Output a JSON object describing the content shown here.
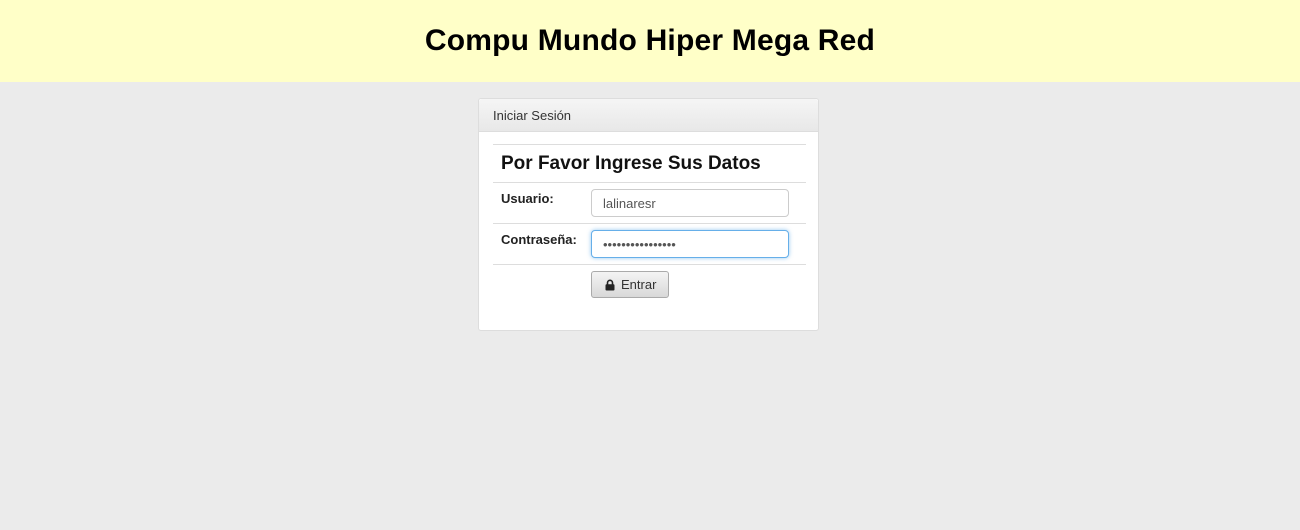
{
  "header": {
    "title": "Compu Mundo Hiper Mega Red"
  },
  "login_panel": {
    "heading": "Iniciar Sesión",
    "form_caption": "Por Favor Ingrese Sus Datos",
    "username": {
      "label": "Usuario:",
      "value": "lalinaresr"
    },
    "password": {
      "label": "Contraseña:",
      "value": "••••••••••••••••"
    },
    "submit": {
      "label": "Entrar",
      "icon": "lock-icon"
    }
  },
  "colors": {
    "header_background": "#ffffc8",
    "page_background": "#ebebeb",
    "focus_border": "#66afe9"
  }
}
